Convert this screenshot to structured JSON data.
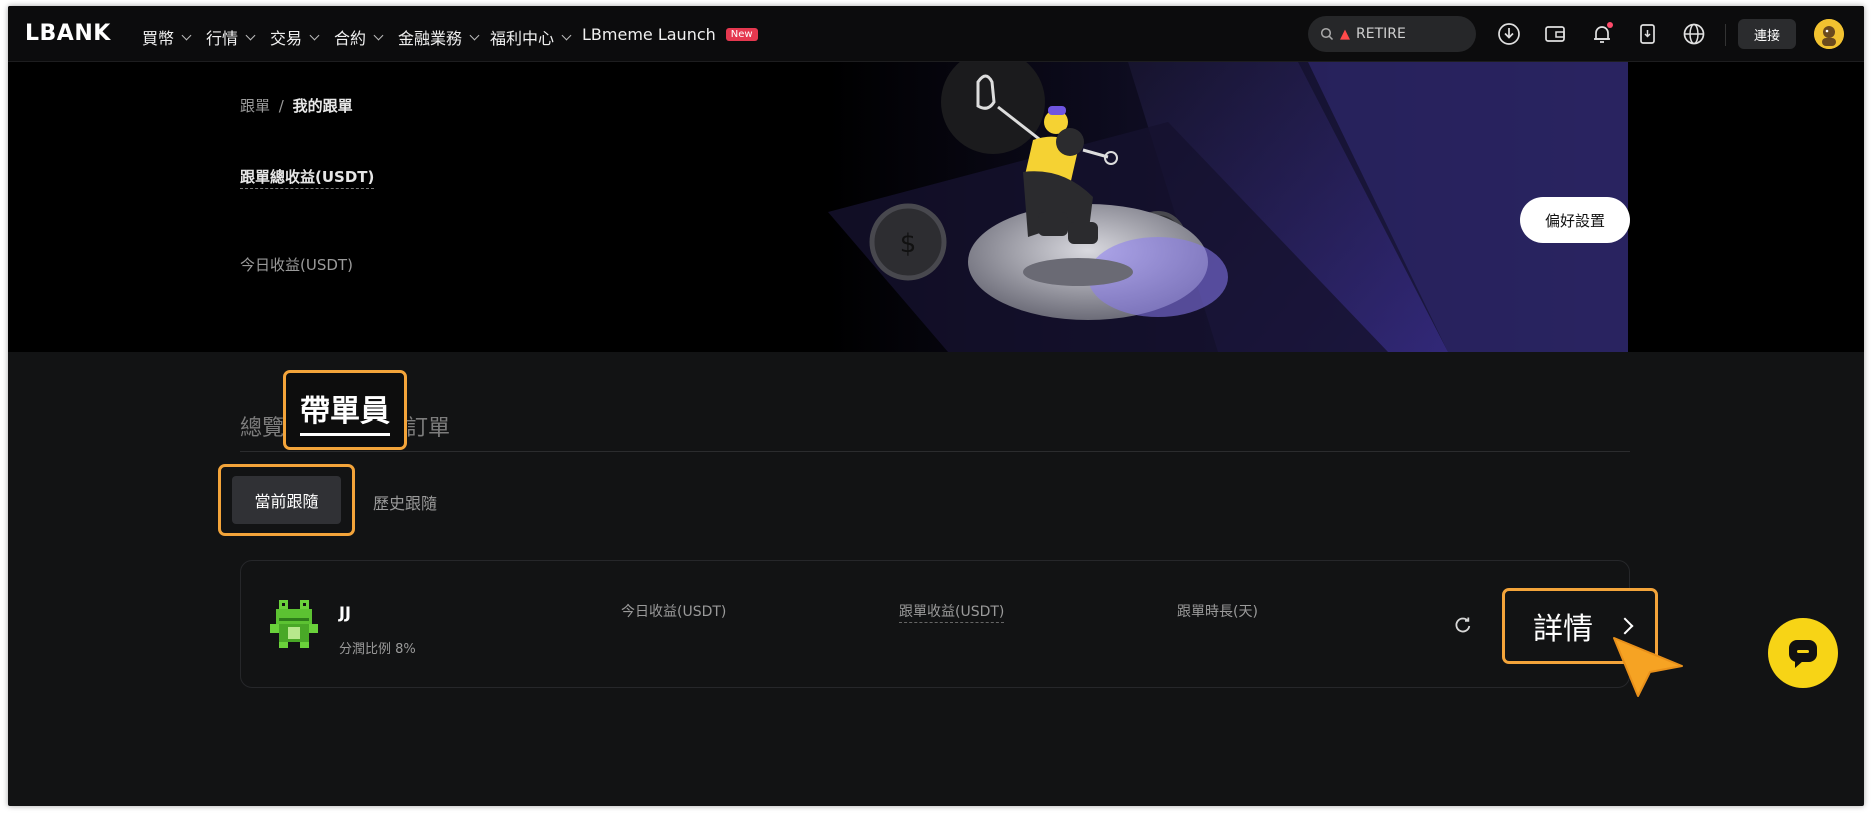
{
  "app": {
    "logo": "LBANK"
  },
  "nav": {
    "items": [
      {
        "label": "買幣"
      },
      {
        "label": "行情"
      },
      {
        "label": "交易"
      },
      {
        "label": "合約"
      },
      {
        "label": "金融業務"
      },
      {
        "label": "福利中心"
      }
    ],
    "launch_label": "LBmeme Launch",
    "launch_badge": "New"
  },
  "search": {
    "value": "RETIRE"
  },
  "header": {
    "connect_label": "連接"
  },
  "hero": {
    "breadcrumb_parent": "跟單",
    "breadcrumb_sep": "/",
    "breadcrumb_current": "我的跟單",
    "total_profit_label": "跟單總收益(USDT)",
    "today_profit_label": "今日收益(USDT)",
    "preference_button": "偏好設置"
  },
  "tabs": {
    "overview": "總覽",
    "leader": "帶單員",
    "orders": "訂單",
    "current": "當前跟隨",
    "history": "歷史跟隨"
  },
  "card": {
    "trader_name": "JJ",
    "share_ratio": "分潤比例 8%",
    "today_profit_label": "今日收益(USDT)",
    "follow_profit_label": "跟單收益(USDT)",
    "duration_label": "跟單時長(天)",
    "details_label": "詳情"
  },
  "colors": {
    "accent": "#f3a43a",
    "chat_button": "#f7d416",
    "badge": "#e5384f",
    "background": "#121314"
  }
}
